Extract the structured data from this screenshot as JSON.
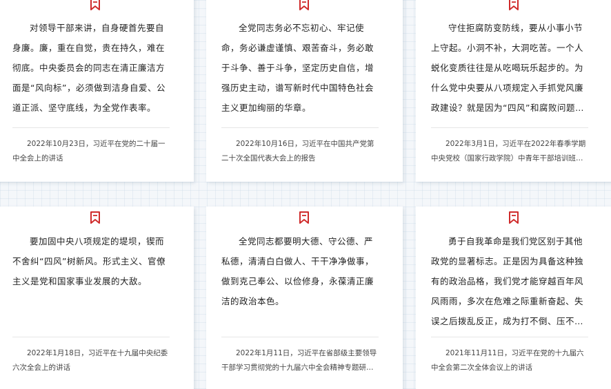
{
  "colors": {
    "accent": "#cf2a2a",
    "text": "#222222",
    "source_text": "#444444"
  },
  "icon": "bookmark-icon",
  "cards": [
    {
      "quote": "对领导干部来讲，自身硬首先要自身廉。廉，重在自觉，贵在持久，难在彻底。中央委员会的同志在清正廉洁方面是“风向标”，必须做到洁身自爱、公道正派、坚守底线，为全党作表率。",
      "source": "2022年10月23日，习近平在党的二十届一中全会上的讲话"
    },
    {
      "quote": "全党同志务必不忘初心、牢记使命，务必谦虚谨慎、艰苦奋斗，务必敢于斗争、善于斗争，坚定历史自信，增强历史主动，谱写新时代中国特色社会主义更加绚丽的华章。",
      "source": "2022年10月16日，习近平在中国共产党第二十次全国代表大会上的报告"
    },
    {
      "quote": "守住拒腐防变防线，要从小事小节上守起。小洞不补，大洞吃苦。一个人蜕化变质往往是从吃喝玩乐起步的。为什么党中央要从八项规定入手抓党风廉政建设？就是因为“四风”和腐败问题互为表里…",
      "source": "2022年3月1日，习近平在2022年春季学期中央党校（国家行政学院）中青年干部培训班…"
    },
    {
      "quote": "要加固中央八项规定的堤坝，锲而不舍纠“四风”树新风。形式主义、官僚主义是党和国家事业发展的大敌。",
      "source": "2022年1月18日，习近平在十九届中央纪委六次全会上的讲话"
    },
    {
      "quote": "全党同志都要明大德、守公德、严私德，清清白白做人、干干净净做事，做到克己奉公、以俭修身，永葆清正廉洁的政治本色。",
      "source": "2022年1月11日，习近平在省部级主要领导干部学习贯彻党的十九届六中全会精神专题研…"
    },
    {
      "quote": "勇于自我革命是我们党区别于其他政党的显著标志。正是因为具备这种独有的政治品格，我们党才能穿越百年风风雨雨，多次在危难之际重新奋起、失误之后拨乱反正，成为打不倒、压不垮的马克…",
      "source": "2021年11月11日，习近平在党的十九届六中全会第二次全体会议上的讲话"
    }
  ]
}
